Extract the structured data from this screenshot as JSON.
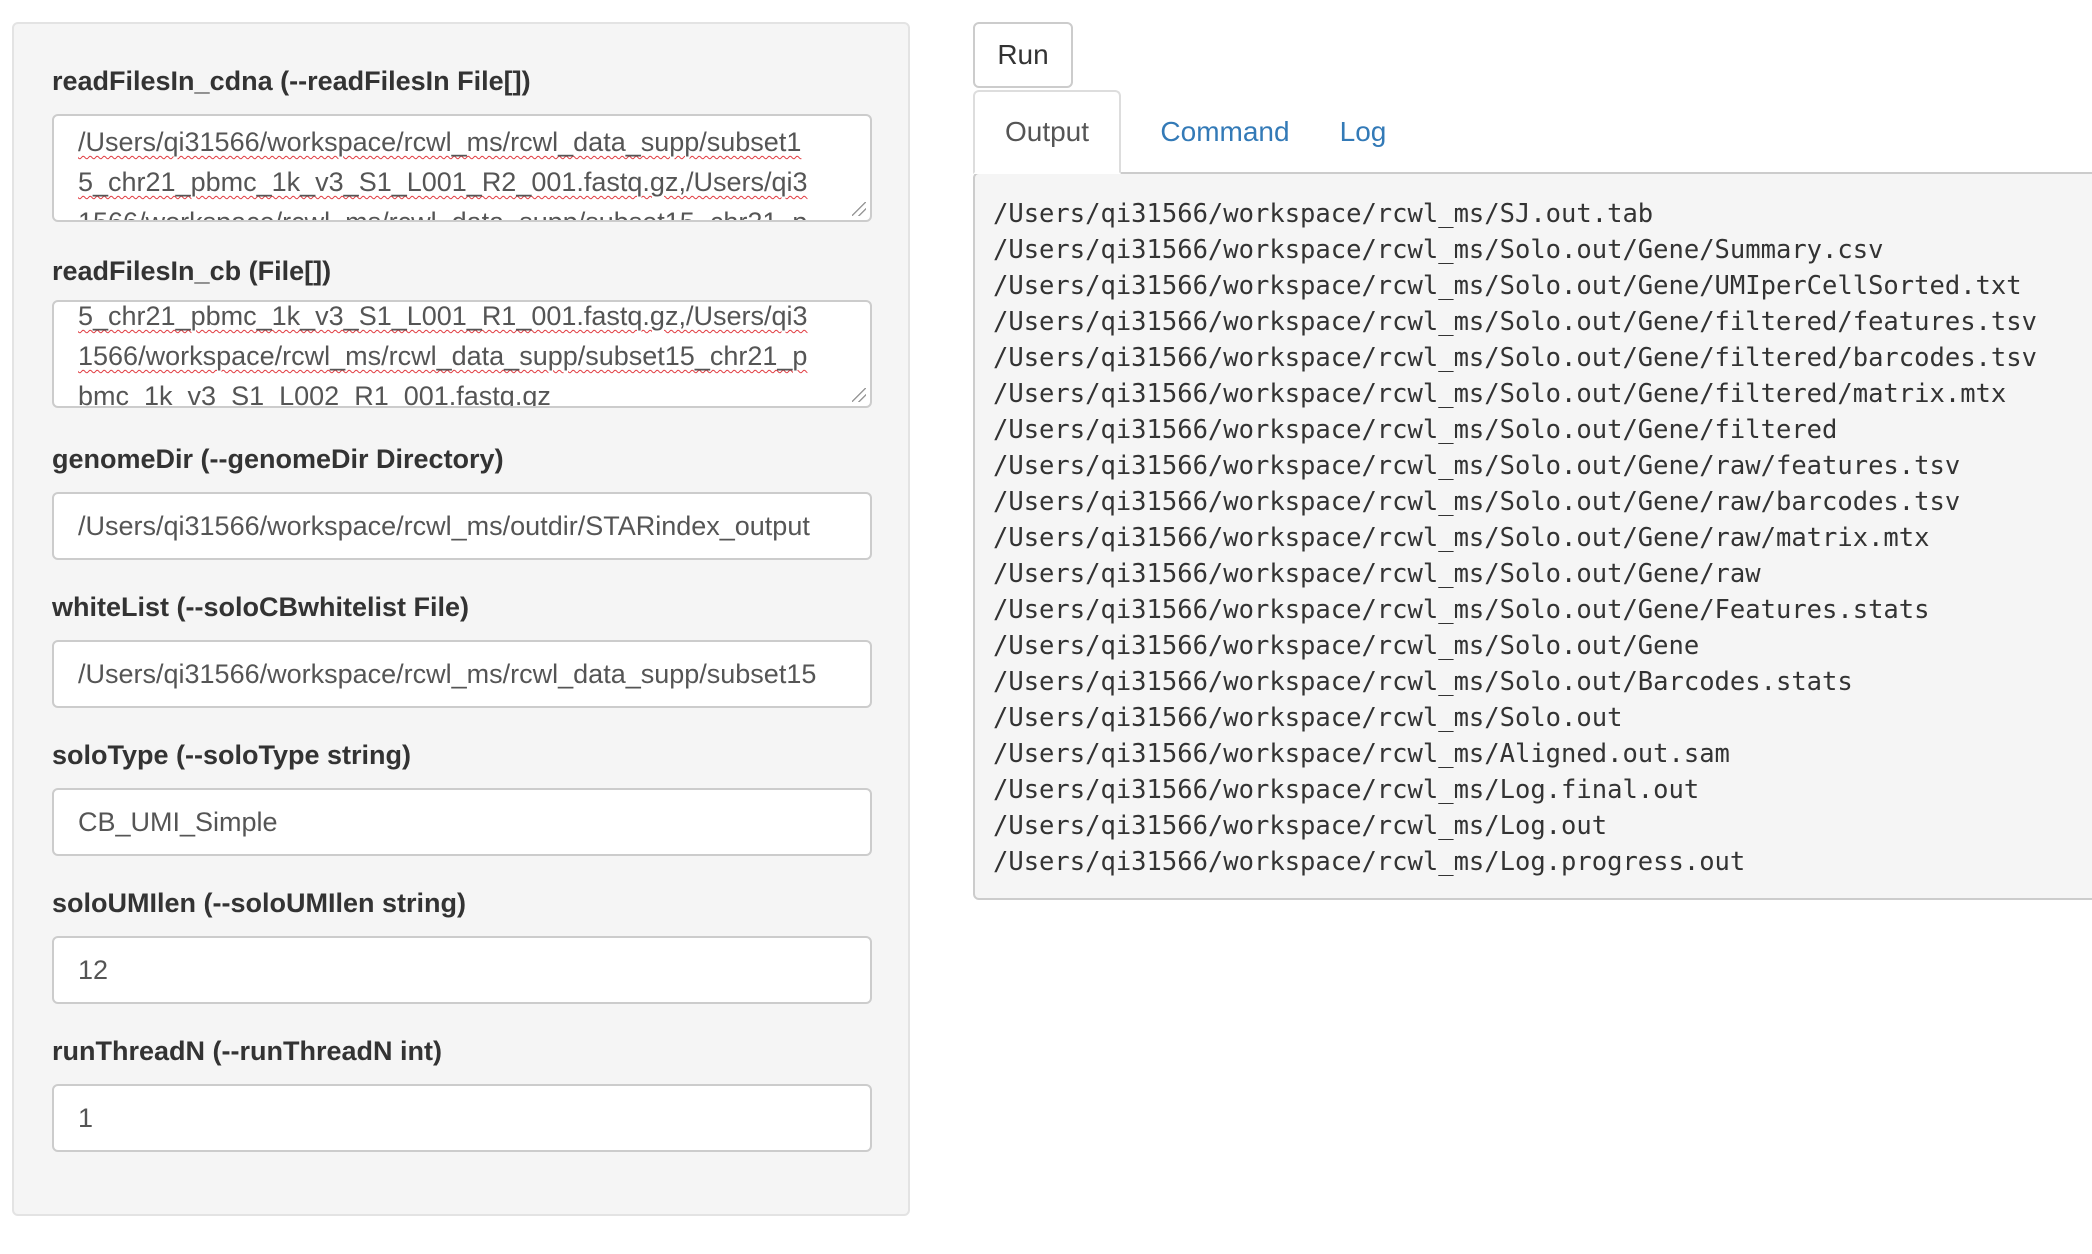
{
  "form": {
    "fields": [
      {
        "label": "readFilesIn_cdna (--readFilesIn File[])",
        "type": "textarea",
        "lines": [
          "/Users/qi31566/workspace/rcwl_ms/rcwl_data_supp/subset1",
          "5_chr21_pbmc_1k_v3_S1_L001_R2_001.fastq.gz,/Users/qi3",
          "1566/workspace/rcwl_ms/rcwl_data_supp/subset15_chr21_p"
        ]
      },
      {
        "label": "readFilesIn_cb (File[])",
        "type": "textarea",
        "lines": [
          "5_chr21_pbmc_1k_v3_S1_L001_R1_001.fastq.gz,/Users/qi3",
          "1566/workspace/rcwl_ms/rcwl_data_supp/subset15_chr21_p",
          "bmc_1k_v3_S1_L002_R1_001.fastq.gz"
        ]
      },
      {
        "label": "genomeDir (--genomeDir Directory)",
        "type": "input",
        "value": "/Users/qi31566/workspace/rcwl_ms/outdir/STARindex_output"
      },
      {
        "label": "whiteList (--soloCBwhitelist File)",
        "type": "input",
        "value": "/Users/qi31566/workspace/rcwl_ms/rcwl_data_supp/subset15"
      },
      {
        "label": "soloType (--soloType string)",
        "type": "input",
        "value": "CB_UMI_Simple"
      },
      {
        "label": "soloUMIlen (--soloUMIlen string)",
        "type": "input",
        "value": "12"
      },
      {
        "label": "runThreadN (--runThreadN int)",
        "type": "input",
        "value": "1"
      }
    ]
  },
  "run_button": {
    "label": "Run"
  },
  "tabs": [
    {
      "label": "Output",
      "active": true
    },
    {
      "label": "Command",
      "active": false
    },
    {
      "label": "Log",
      "active": false
    }
  ],
  "output": {
    "lines": [
      "/Users/qi31566/workspace/rcwl_ms/SJ.out.tab",
      "/Users/qi31566/workspace/rcwl_ms/Solo.out/Gene/Summary.csv",
      "/Users/qi31566/workspace/rcwl_ms/Solo.out/Gene/UMIperCellSorted.txt",
      "/Users/qi31566/workspace/rcwl_ms/Solo.out/Gene/filtered/features.tsv",
      "/Users/qi31566/workspace/rcwl_ms/Solo.out/Gene/filtered/barcodes.tsv",
      "/Users/qi31566/workspace/rcwl_ms/Solo.out/Gene/filtered/matrix.mtx",
      "/Users/qi31566/workspace/rcwl_ms/Solo.out/Gene/filtered",
      "/Users/qi31566/workspace/rcwl_ms/Solo.out/Gene/raw/features.tsv",
      "/Users/qi31566/workspace/rcwl_ms/Solo.out/Gene/raw/barcodes.tsv",
      "/Users/qi31566/workspace/rcwl_ms/Solo.out/Gene/raw/matrix.mtx",
      "/Users/qi31566/workspace/rcwl_ms/Solo.out/Gene/raw",
      "/Users/qi31566/workspace/rcwl_ms/Solo.out/Gene/Features.stats",
      "/Users/qi31566/workspace/rcwl_ms/Solo.out/Gene",
      "/Users/qi31566/workspace/rcwl_ms/Solo.out/Barcodes.stats",
      "/Users/qi31566/workspace/rcwl_ms/Solo.out",
      "/Users/qi31566/workspace/rcwl_ms/Aligned.out.sam",
      "/Users/qi31566/workspace/rcwl_ms/Log.final.out",
      "/Users/qi31566/workspace/rcwl_ms/Log.out",
      "/Users/qi31566/workspace/rcwl_ms/Log.progress.out"
    ]
  }
}
